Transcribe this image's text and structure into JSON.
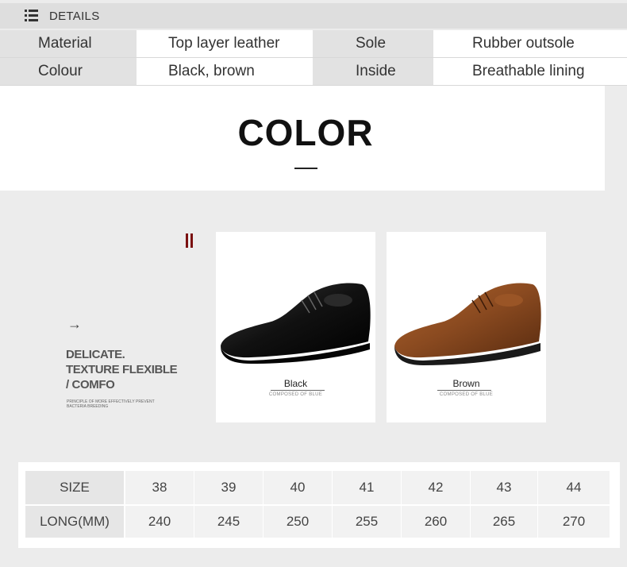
{
  "details": {
    "title": "DETAILS",
    "icon": "list-icon"
  },
  "specs": [
    {
      "label": "Material",
      "value": "Top layer leather",
      "label2": "Sole",
      "value2": "Rubber outsole"
    },
    {
      "label": "Colour",
      "value": "Black, brown",
      "label2": "Inside",
      "value2": "Breathable lining"
    }
  ],
  "color_section": {
    "title": "COLOR",
    "slogan_lines": [
      "DELICATE.",
      "TEXTURE FLEXIBLE",
      "/ COMFO"
    ],
    "slogan_small_lines": [
      "PRINCIPLE OF MORE EFFECTIVELY PREVENT",
      "BACTERIA BREEDING"
    ],
    "arrow": "→",
    "cards": [
      {
        "label": "Black",
        "sub": "COMPOSED OF BLUE",
        "color": "#141414"
      },
      {
        "label": "Brown",
        "sub": "COMPOSED OF BLUE",
        "color": "#8a4a20"
      }
    ]
  },
  "size_table": {
    "headers": [
      "SIZE",
      "38",
      "39",
      "40",
      "41",
      "42",
      "43",
      "44"
    ],
    "rows": [
      [
        "LONG(MM)",
        "240",
        "245",
        "250",
        "255",
        "260",
        "265",
        "270"
      ]
    ]
  }
}
